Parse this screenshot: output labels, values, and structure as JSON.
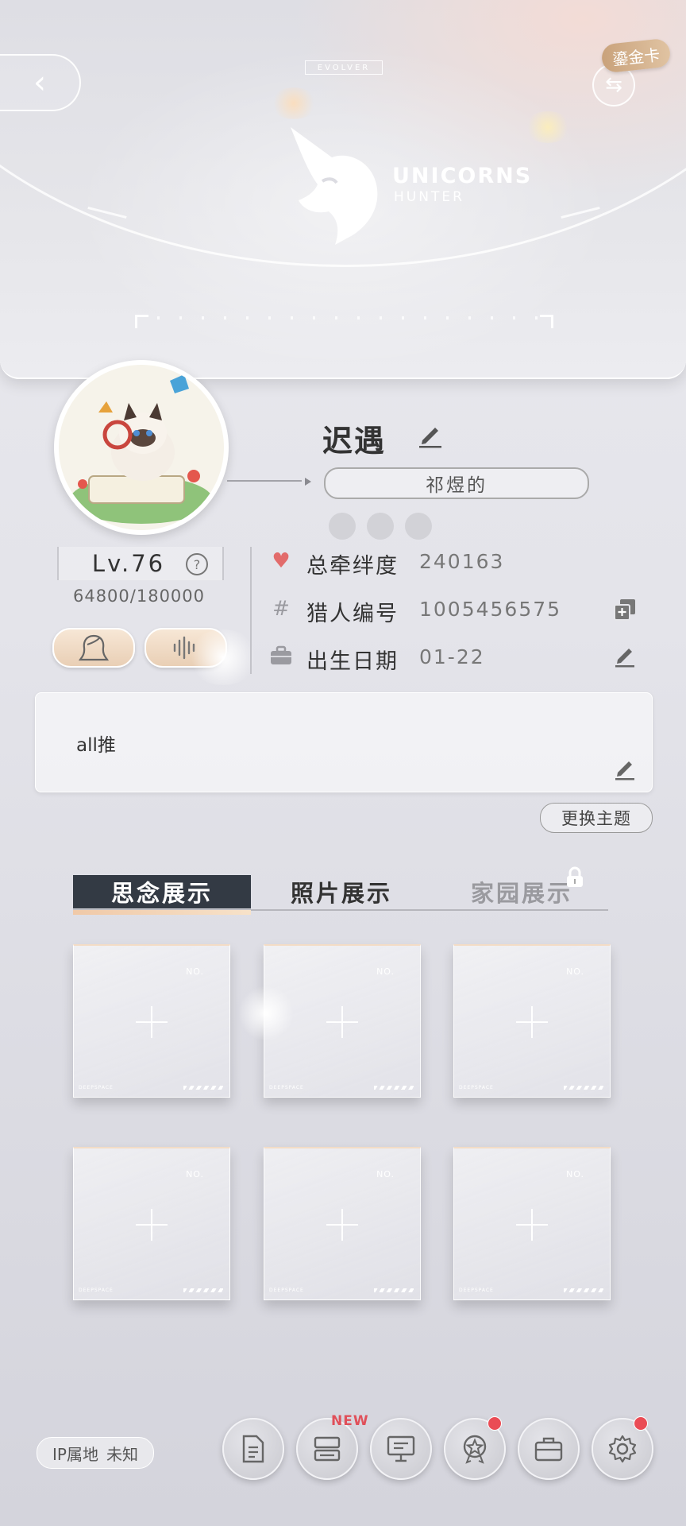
{
  "banner": {
    "tag": "EVOLVER",
    "logo_title": "UNICORNS",
    "logo_subtitle": "HUNTER",
    "card_badge": "鎏金卡"
  },
  "profile": {
    "nickname": "迟遇",
    "title_badge": "祁煜的",
    "level": "Lv.76",
    "experience": "64800/180000"
  },
  "info": {
    "bond": {
      "label": "总牵绊度",
      "value": "240163",
      "icon": "heart-icon"
    },
    "hunter_id": {
      "label": "猎人编号",
      "value": "1005456575",
      "icon": "hash-icon"
    },
    "birthday": {
      "label": "出生日期",
      "value": "01-22",
      "icon": "briefcase-icon"
    }
  },
  "signature": {
    "text": "all推"
  },
  "change_theme_label": "更换主题",
  "tabs": [
    {
      "label": "思念展示",
      "active": true
    },
    {
      "label": "照片展示",
      "active": false
    },
    {
      "label": "家园展示",
      "active": false,
      "locked": true
    }
  ],
  "slot": {
    "no_label": "NO.",
    "footer": "DEEPSPACE"
  },
  "bottom": {
    "ip_label": "IP属地",
    "ip_value": "未知",
    "new_badge": "NEW"
  },
  "colors": {
    "accent_dark": "#333a44",
    "accent_gold": "#e9cfb5",
    "badge_red": "#ea4c55",
    "heart": "#e26b6b"
  }
}
